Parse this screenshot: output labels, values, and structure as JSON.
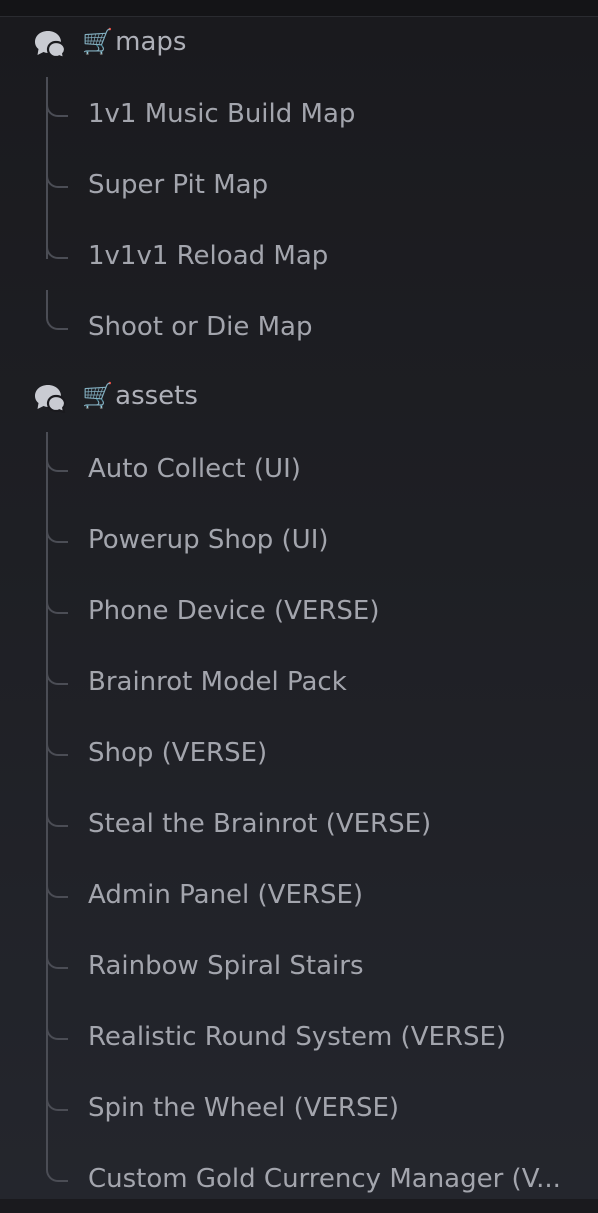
{
  "forums": [
    {
      "title": "maps",
      "cart_emoji": "🛒",
      "icon": "forum-bubbles-icon",
      "threads": [
        "1v1 Music Build Map",
        "Super Pit Map",
        "1v1v1 Reload Map",
        "Shoot or Die Map"
      ]
    },
    {
      "title": "assets",
      "cart_emoji": "🛒",
      "icon": "forum-bubbles-icon",
      "threads": [
        "Auto Collect (UI)",
        "Powerup Shop (UI)",
        "Phone Device (VERSE)",
        "Brainrot Model Pack",
        "Shop (VERSE)",
        "Steal the Brainrot (VERSE)",
        "Admin Panel (VERSE)",
        "Rainbow Spiral Stairs",
        "Realistic Round System (VERSE)",
        "Spin the Wheel (VERSE)",
        "Custom Gold Currency Manager (V..."
      ]
    }
  ],
  "colors": {
    "background_top": "#1a1a1e",
    "background_bottom": "#24262d",
    "text": "#a3a5ad",
    "spine": "#4b4d55",
    "icon": "#c9cbd2"
  }
}
